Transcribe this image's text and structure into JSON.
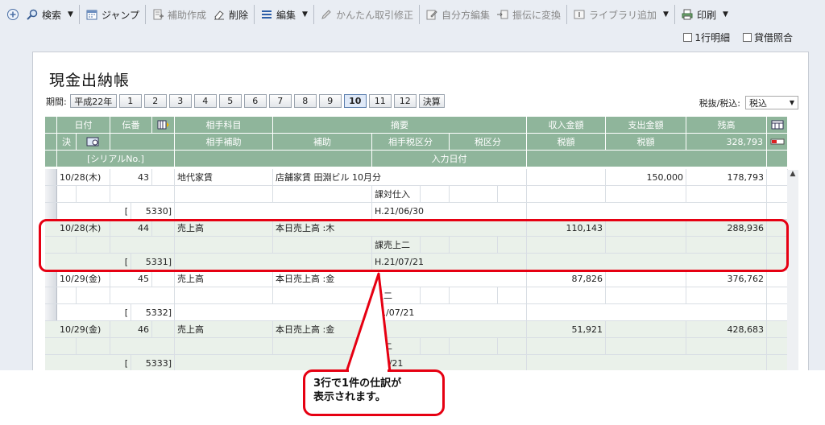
{
  "toolbar": {
    "search": "検索",
    "jump": "ジャンプ",
    "sub_create": "補助作成",
    "delete": "削除",
    "edit": "編集",
    "easy_fix": "かんたん取引修正",
    "own_edit": "自分方編集",
    "convert": "振伝に変換",
    "library_add": "ライブラリ追加",
    "print": "印刷"
  },
  "options": {
    "one_line": "1行明細",
    "balance_check": "貸借照合"
  },
  "page_title": "現金出納帳",
  "period": {
    "label": "期間:",
    "era": "平成22年",
    "months": [
      "1",
      "2",
      "3",
      "4",
      "5",
      "6",
      "7",
      "8",
      "9",
      "10",
      "11",
      "12"
    ],
    "active": "10",
    "settle": "決算"
  },
  "tax": {
    "label": "税抜/税込:",
    "value": "税込"
  },
  "headers": {
    "date": "日付",
    "voucher": "伝番",
    "account": "相手科目",
    "summary": "摘要",
    "income": "収入金額",
    "expense": "支出金額",
    "balance": "残高",
    "settle": "決",
    "sub": "相手補助",
    "aux": "補助",
    "counter_tax": "相手税区分",
    "tax_class": "税区分",
    "tax_amount1": "税額",
    "tax_amount2": "税額",
    "balance_value": "328,793",
    "serial": "[シリアルNo.]",
    "input_date": "入力日付"
  },
  "entries": [
    {
      "date": "10/28(木)",
      "voucher": "43",
      "account": "地代家賃",
      "summary": "店舗家賃 田淵ビル 10月分",
      "income": "",
      "expense": "150,000",
      "balance": "178,793",
      "counter_tax": "課対仕入",
      "serial_open": "[",
      "serial": "5330]",
      "input_date": "H.21/06/30"
    },
    {
      "date": "10/28(木)",
      "voucher": "44",
      "account": "売上高",
      "summary": "本日売上高 :木",
      "income": "110,143",
      "expense": "",
      "balance": "288,936",
      "counter_tax": "課売上二",
      "serial_open": "[",
      "serial": "5331]",
      "input_date": "H.21/07/21"
    },
    {
      "date": "10/29(金)",
      "voucher": "45",
      "account": "売上高",
      "summary": "本日売上高 :金",
      "income": "87,826",
      "expense": "",
      "balance": "376,762",
      "counter_tax": "上二",
      "serial_open": "[",
      "serial": "5332]",
      "input_date": "21/07/21"
    },
    {
      "date": "10/29(金)",
      "voucher": "46",
      "account": "売上高",
      "summary": "本日売上高 :金",
      "income": "51,921",
      "expense": "",
      "balance": "428,683",
      "counter_tax": "上二",
      "serial_open": "[",
      "serial": "5333]",
      "input_date": "/07/21"
    }
  ],
  "callout": {
    "line1": "3行で1件の仕訳が",
    "line2": "表示されます。"
  },
  "colors": {
    "header_green": "#8fb59b",
    "annotation_red": "#e60012"
  }
}
